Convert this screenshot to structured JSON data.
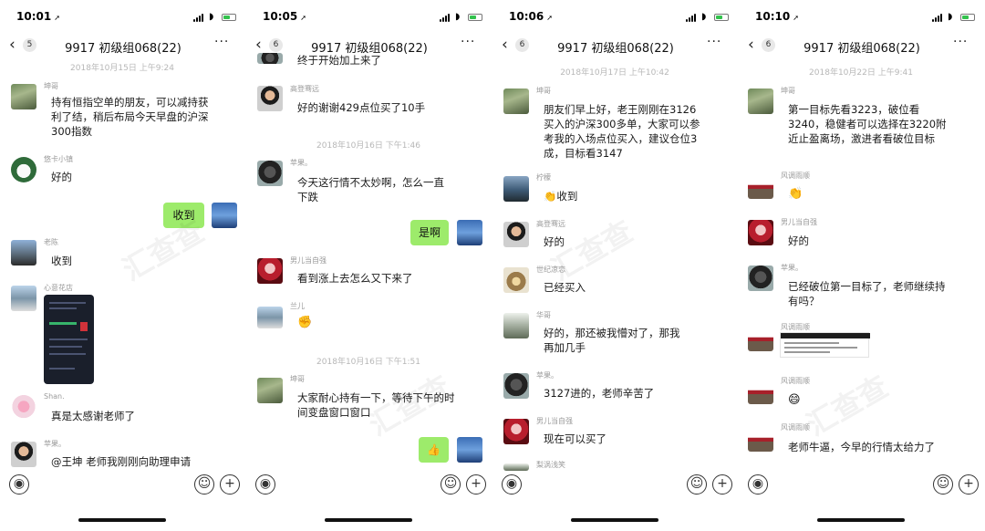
{
  "panels": [
    {
      "time": "10:01",
      "unread": "5",
      "title": "9917 初级组068(22)",
      "timestamps": [
        "2018年10月15日 上午9:24"
      ],
      "messages": {
        "m1_sender": "坤哥",
        "m1_text": "持有恒指空单的朋友，可以减持获利了结，稍后布局今天早盘的沪深300指数",
        "m2_sender": "悠卡小镇",
        "m2_text": "好的",
        "m3_text": "收到",
        "m4_sender": "老陈",
        "m4_text": "收到",
        "m5_sender": "心意花店",
        "m6_sender": "Shan.",
        "m6_text": "真是太感谢老师了",
        "m7_sender": "苹果。",
        "m7_text": "@王坤 老师我刚刚向助理申请"
      }
    },
    {
      "time": "10:05",
      "unread": "6",
      "title": "9917 初级组068(22)",
      "timestamps": [
        "2018年10月16日 下午1:46",
        "2018年10月16日 下午1:51"
      ],
      "messages": {
        "m0_text": "终于开始加上来了",
        "m1_sender": "高登骞远",
        "m1_text": "好的谢谢429点位买了10手",
        "m2_sender": "苹果。",
        "m2_text": "今天这行情不太妙啊，怎么一直下跌",
        "m3_text": "是啊",
        "m4_sender": "男儿当自强",
        "m4_text": "看到涨上去怎么又下来了",
        "m5_sender": "兰儿",
        "m6_sender": "坤哥",
        "m6_text": "大家耐心持有一下，等待下午的时间变盘窗口窗口"
      }
    },
    {
      "time": "10:06",
      "unread": "6",
      "title": "9917 初级组068(22)",
      "timestamps": [
        "2018年10月17日 上午10:42"
      ],
      "messages": {
        "m1_sender": "坤哥",
        "m1_text": "朋友们早上好，老王刚刚在3126买入的沪深300多单，大家可以参考我的入场点位买入，建议仓位3成，目标看3147",
        "m2_sender": "柠檬",
        "m2_text": "收到",
        "m3_sender": "高登骞远",
        "m3_text": "好的",
        "m4_sender": "世纪凉恋",
        "m4_text": "已经买入",
        "m5_sender": "华哥",
        "m5_text": "好的，那还被我懵对了，那我再加几手",
        "m6_sender": "苹果。",
        "m6_text": "3127进的，老师辛苦了",
        "m7_sender": "男儿当自强",
        "m7_text": "现在可以买了",
        "m8_sender": "梨涡浅笑"
      }
    },
    {
      "time": "10:10",
      "unread": "6",
      "title": "9917 初级组068(22)",
      "timestamps": [
        "2018年10月22日 上午9:41"
      ],
      "messages": {
        "m1_sender": "坤哥",
        "m1_text": "第一目标先看3223，破位看3240，稳健者可以选择在3220附近止盈离场，激进者看破位目标",
        "m2_sender": "风调雨顺",
        "m3_sender": "男儿当自强",
        "m3_text": "好的",
        "m4_sender": "苹果。",
        "m4_text": "已经破位第一目标了，老师继续持有吗？",
        "m5_sender": "风调雨顺",
        "m6_sender": "风调雨顺",
        "m7_sender": "风调雨顺",
        "m7_text": "老师牛逼，今早的行情太给力了"
      }
    }
  ],
  "watermark": "汇查查",
  "icons": {
    "back": "‹",
    "more": "···",
    "voice": "voice-icon",
    "emoji": "emoji-icon",
    "plus": "plus-icon"
  }
}
